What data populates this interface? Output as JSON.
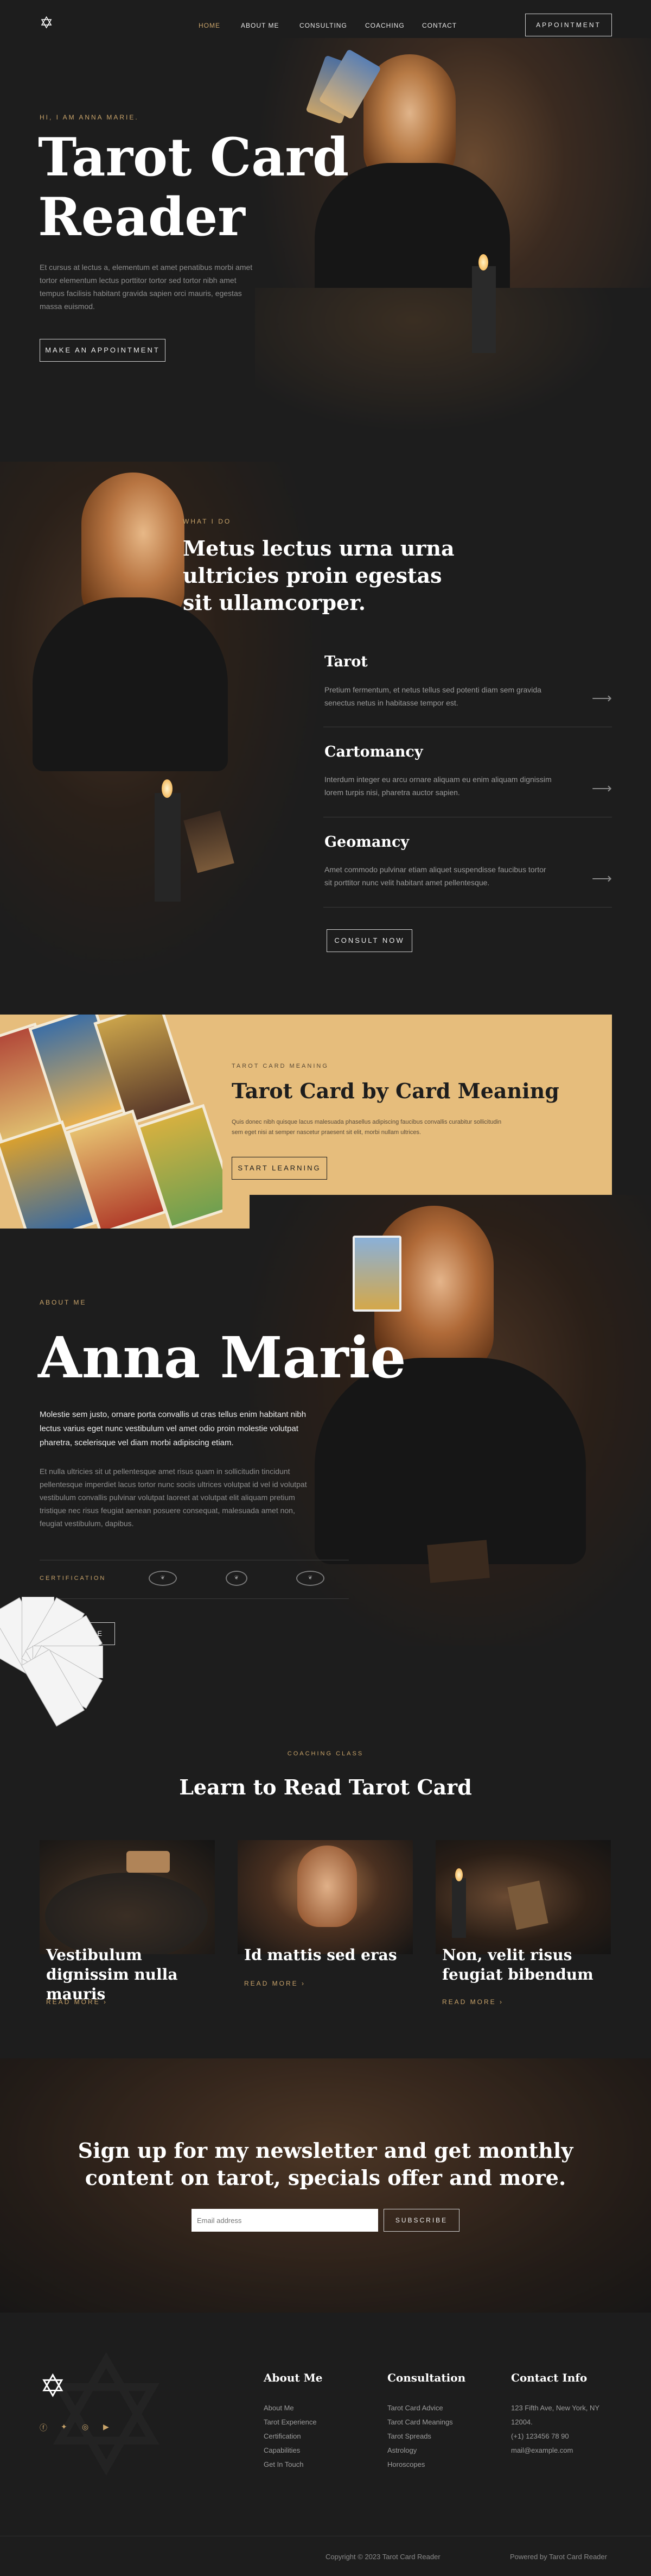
{
  "nav": {
    "links": [
      "HOME",
      "ABOUT ME",
      "CONSULTING",
      "COACHING",
      "CONTACT"
    ],
    "cta": "APPOINTMENT"
  },
  "hero": {
    "eyebrow": "HI, I AM ANNA MARIE.",
    "title_line1": "Tarot Card",
    "title_line2": "Reader",
    "text": "Et cursus at lectus a, elementum et amet penatibus morbi amet tortor elementum lectus porttitor tortor sed tortor nibh amet tempus facilisis habitant gravida sapien orci mauris, egestas massa euismod.",
    "button": "MAKE AN APPOINTMENT"
  },
  "services": {
    "eyebrow": "WHAT I DO",
    "heading": "Metus lectus urna urna ultricies proin egestas sit ullamcorper.",
    "items": [
      {
        "title": "Tarot",
        "text": "Pretium fermentum, et netus tellus sed potenti diam sem gravida senectus netus in habitasse tempor est.",
        "arrow": "⟶"
      },
      {
        "title": "Cartomancy",
        "text": "Interdum integer eu arcu ornare aliquam eu enim aliquam dignissim lorem turpis nisi, pharetra auctor sapien.",
        "arrow": "⟶"
      },
      {
        "title": "Geomancy",
        "text": "Amet commodo pulvinar etiam aliquet suspendisse faucibus tortor sit porttitor nunc velit habitant amet pellentesque.",
        "arrow": "⟶"
      }
    ],
    "button": "CONSULT NOW"
  },
  "banner": {
    "eyebrow": "TAROT CARD MEANING",
    "title": "Tarot Card by Card Meaning",
    "text": "Quis donec nibh quisque lacus malesuada phasellus adipiscing faucibus convallis curabitur sollicitudin sem eget nisi at semper nascetur praesent sit elit, morbi nullam ultrices.",
    "button": "START LEARNING"
  },
  "about": {
    "eyebrow": "ABOUT ME",
    "name": "Anna Marie",
    "lead": "Molestie sem justo, ornare porta convallis ut cras tellus enim habitant nibh lectus varius eget nunc vestibulum vel amet odio proin molestie volutpat pharetra, scelerisque vel diam morbi adipiscing etiam.",
    "text": "Et nulla ultricies sit ut pellentesque amet risus quam in sollicitudin tincidunt pellentesque imperdiet lacus tortor nunc sociis ultrices volutpat id vel id volutpat vestibulum convallis pulvinar volutpat laoreet at volutpat elit aliquam pretium tristique nec risus feugiat aenean posuere consequat, malesuada amet non, feugiat vestibulum, dapibus.",
    "cert_label": "CERTIFICATION",
    "button": "MORE"
  },
  "coaching": {
    "eyebrow": "COACHING CLASS",
    "title": "Learn to Read Tarot Card",
    "cards": [
      {
        "title": "Vestibulum dignissim nulla mauris",
        "link": "READ MORE"
      },
      {
        "title": "Id mattis sed eras",
        "link": "READ MORE"
      },
      {
        "title": "Non, velit risus feugiat bibendum",
        "link": "READ MORE"
      }
    ]
  },
  "newsletter": {
    "title": "Sign up for my newsletter and get monthly content on tarot, specials offer and more.",
    "placeholder": "Email address",
    "button": "SUBSCRIBE"
  },
  "footer": {
    "col1_title": "About Me",
    "col1_links": [
      "About Me",
      "Tarot Experience",
      "Certification",
      "Capabilities",
      "Get In Touch"
    ],
    "col2_title": "Consultation",
    "col2_links": [
      "Tarot Card Advice",
      "Tarot Card Meanings",
      "Tarot Spreads",
      "Astrology",
      "Horoscopes"
    ],
    "col3_title": "Contact Info",
    "col3_lines": [
      "123 Fifth Ave, New York, NY",
      "12004.",
      "(+1) 123456 78 90",
      "mail@example.com"
    ],
    "copyright": "Copyright © 2023 Tarot Card Reader",
    "powered": "Powered by Tarot Card Reader"
  },
  "colors": {
    "background": "#1d1d1d",
    "accent": "#c9a46a",
    "banner": "#e6bd7c"
  }
}
